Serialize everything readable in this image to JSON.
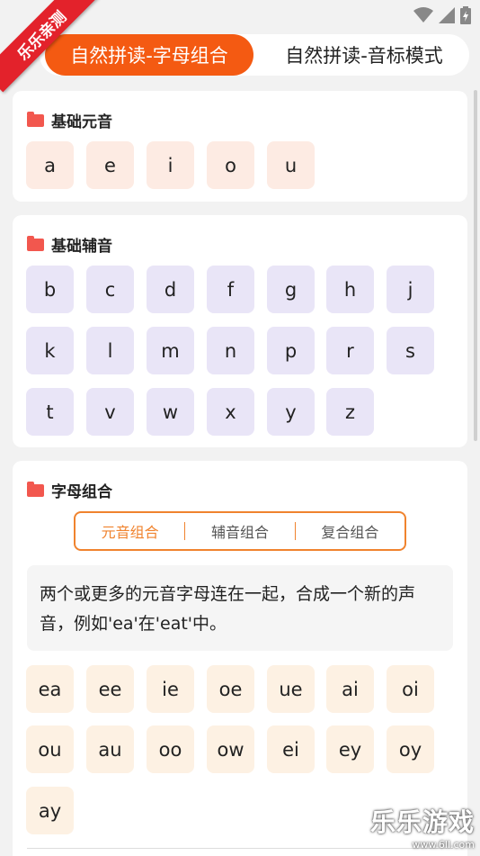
{
  "ribbon": "乐乐亲测",
  "header": {
    "tab_active": "自然拼读-字母组合",
    "tab_inactive": "自然拼读-音标模式"
  },
  "vowels": {
    "title": "基础元音",
    "letters": [
      "a",
      "e",
      "i",
      "o",
      "u"
    ]
  },
  "consonants": {
    "title": "基础辅音",
    "letters": [
      "b",
      "c",
      "d",
      "f",
      "g",
      "h",
      "j",
      "k",
      "l",
      "m",
      "n",
      "p",
      "r",
      "s",
      "t",
      "v",
      "w",
      "x",
      "y",
      "z"
    ]
  },
  "combos": {
    "title": "字母组合",
    "subtabs": [
      "元音组合",
      "辅音组合",
      "复合组合"
    ],
    "active_subtab": "元音组合",
    "description": "两个或更多的元音字母连在一起，合成一个新的声音，例如'ea'在'eat'中。",
    "letters": [
      "ea",
      "ee",
      "ie",
      "oe",
      "ue",
      "ai",
      "oi",
      "ou",
      "au",
      "oo",
      "ow",
      "ei",
      "ey",
      "oy",
      "ay"
    ]
  },
  "watermark": {
    "brand": "乐乐游戏",
    "url": "www.6ll.com"
  },
  "colors": {
    "accent": "#f45a12",
    "subtab_accent": "#f0832e",
    "vowel_tile": "#fdebe3",
    "consonant_tile": "#e9e5f7",
    "combo_tile": "#fdf1e3"
  }
}
